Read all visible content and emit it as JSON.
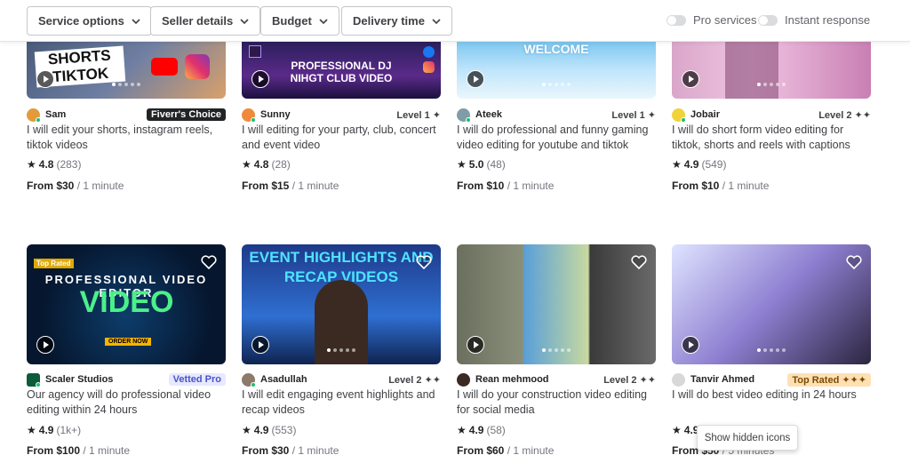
{
  "filters": {
    "service_options": "Service options",
    "seller_details": "Seller details",
    "budget": "Budget",
    "delivery_time": "Delivery time",
    "pro_services": "Pro services",
    "instant_response": "Instant response"
  },
  "gigs": [
    {
      "seller": "Sam",
      "badge": "Fiverr's Choice",
      "title": "I will edit your shorts, instagram reels, tiktok videos",
      "rating": "4.8",
      "reviews": "(283)",
      "price": "From $30",
      "delivery": "/ 1 minute",
      "thumb_text": "SHORTS TIKTOK"
    },
    {
      "seller": "Sunny",
      "level": "Level 1 ✦",
      "title": "I will editing for your party, club, concert and event video",
      "rating": "4.8",
      "reviews": "(28)",
      "price": "From $15",
      "delivery": "/ 1 minute",
      "thumb_text": "PROFESSIONAL DJ NIHGT CLUB VIDEO"
    },
    {
      "seller": "Ateek",
      "level": "Level 1 ✦",
      "title": "I will do professional and funny gaming video editing for youtube and tiktok",
      "rating": "5.0",
      "reviews": "(48)",
      "price": "From $10",
      "delivery": "/ 1 minute",
      "thumb_text": "WELCOME"
    },
    {
      "seller": "Jobair",
      "level": "Level 2 ✦✦",
      "title": "I will do short form video editing for tiktok, shorts and reels with captions",
      "rating": "4.9",
      "reviews": "(549)",
      "price": "From $10",
      "delivery": "/ 1 minute",
      "thumb_text": ""
    },
    {
      "seller": "Scaler Studios",
      "badge": "Vetted Pro",
      "title": "Our agency will do professional video editing within 24 hours",
      "rating": "4.9",
      "reviews": "(1k+)",
      "price": "From $100",
      "delivery": "/ 1 minute",
      "thumb_text": "PROFESSIONAL VIDEO EDITOR"
    },
    {
      "seller": "Asadullah",
      "level": "Level 2 ✦✦",
      "title": "I will edit engaging event highlights and recap videos",
      "rating": "4.9",
      "reviews": "(553)",
      "price": "From $30",
      "delivery": "/ 1 minute",
      "thumb_text": "EVENT HIGHLIGHTS AND RECAP VIDEOS"
    },
    {
      "seller": "Rean mehmood",
      "level": "Level 2 ✦✦",
      "title": "I will do your construction video editing for social media",
      "rating": "4.9",
      "reviews": "(58)",
      "price": "From $60",
      "delivery": "/ 1 minute",
      "thumb_text": ""
    },
    {
      "seller": "Tanvir Ahmed",
      "badge": "Top Rated ✦✦✦",
      "title": "I will do best video editing in 24 hours",
      "rating": "4.9",
      "reviews": "",
      "price": "From $50",
      "delivery": "/ 5 minutes",
      "thumb_text": ""
    }
  ],
  "tooltip": "Show hidden icons",
  "colors": {
    "accent": "#1dbf73",
    "text": "#404145",
    "fiverr_choice_bg": "#222325",
    "vetted_bg": "#e6e9ff",
    "top_rated_bg": "#ffe0b3"
  }
}
